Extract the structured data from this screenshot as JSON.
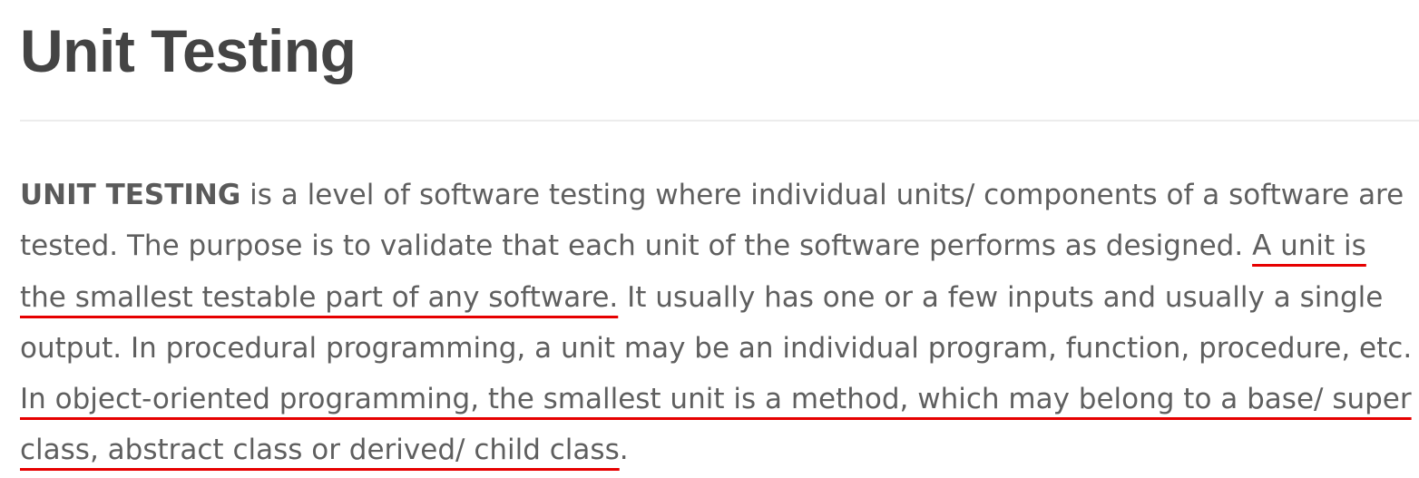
{
  "article": {
    "title": "Unit Testing",
    "lead_term": "UNIT TESTING",
    "segment_1": " is a level of software testing where individual units/ components of a software are tested. The purpose is to validate that each unit of the software performs as designed. ",
    "highlight_1": "A unit is the smallest testable part of any software.",
    "segment_2": " It usually has one or a few inputs and usually a single output. In procedural programming, a unit may be an individual program, function, procedure, etc. ",
    "highlight_2": "In object-oriented programming, the smallest unit is a method, which may belong to a base/ super class, abstract class or derived/ child class",
    "segment_3": "."
  },
  "colors": {
    "title": "#444444",
    "body": "#5f5f5f",
    "underline": "#e60000",
    "divider": "#ececec"
  }
}
